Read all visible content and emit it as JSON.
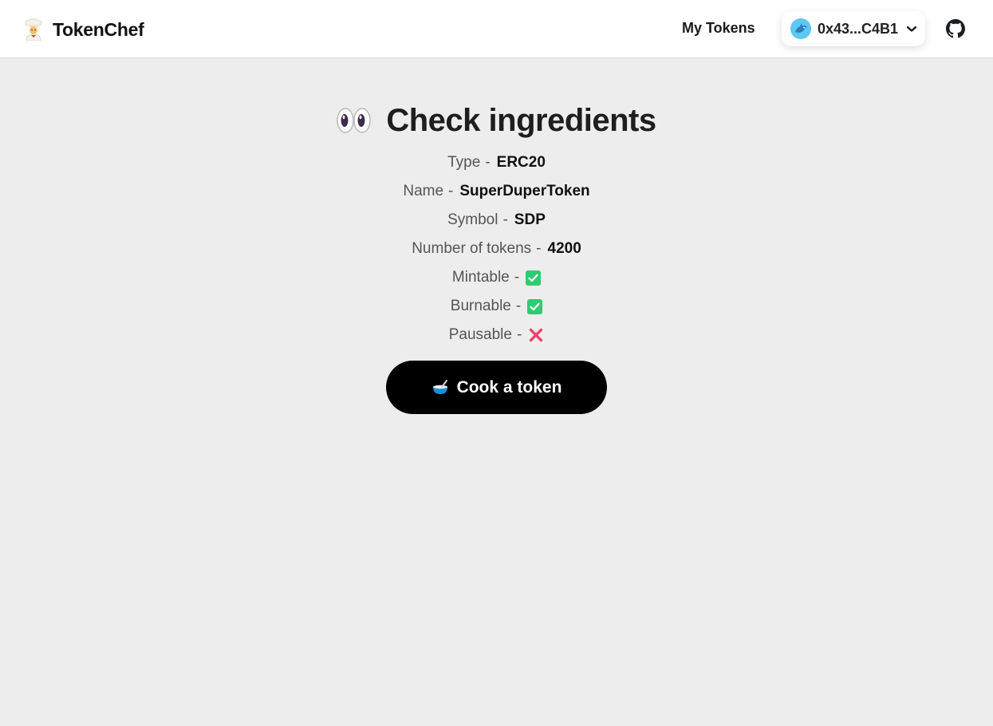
{
  "header": {
    "brand": {
      "name": "TokenChef",
      "icon": "chef-icon"
    },
    "my_tokens_label": "My Tokens",
    "account": {
      "address": "0x43...C4B1",
      "avatar_icon": "dolphin-avatar-icon",
      "dropdown_icon": "chevron-down-icon"
    },
    "github_icon": "github-icon"
  },
  "main": {
    "heading": "Check ingredients",
    "heading_icon": "eyes-icon",
    "details": [
      {
        "label": "Type",
        "value": "ERC20"
      },
      {
        "label": "Name",
        "value": "SuperDuperToken"
      },
      {
        "label": "Symbol",
        "value": "SDP"
      },
      {
        "label": "Number of tokens",
        "value": "4200"
      },
      {
        "label": "Mintable",
        "checked": true,
        "icon": "checkmark-icon"
      },
      {
        "label": "Burnable",
        "checked": true,
        "icon": "checkmark-icon"
      },
      {
        "label": "Pausable",
        "checked": false,
        "icon": "cross-icon"
      }
    ],
    "cook_button": {
      "label": "Cook a token",
      "icon": "bowl-icon"
    },
    "separator": "-"
  },
  "colors": {
    "background": "#ededed",
    "navbar": "#ffffff",
    "primary_button": "#000000",
    "check_green": "#2ecc71",
    "cross_red": "#e8466b",
    "avatar_blue": "#5ec7f3"
  }
}
